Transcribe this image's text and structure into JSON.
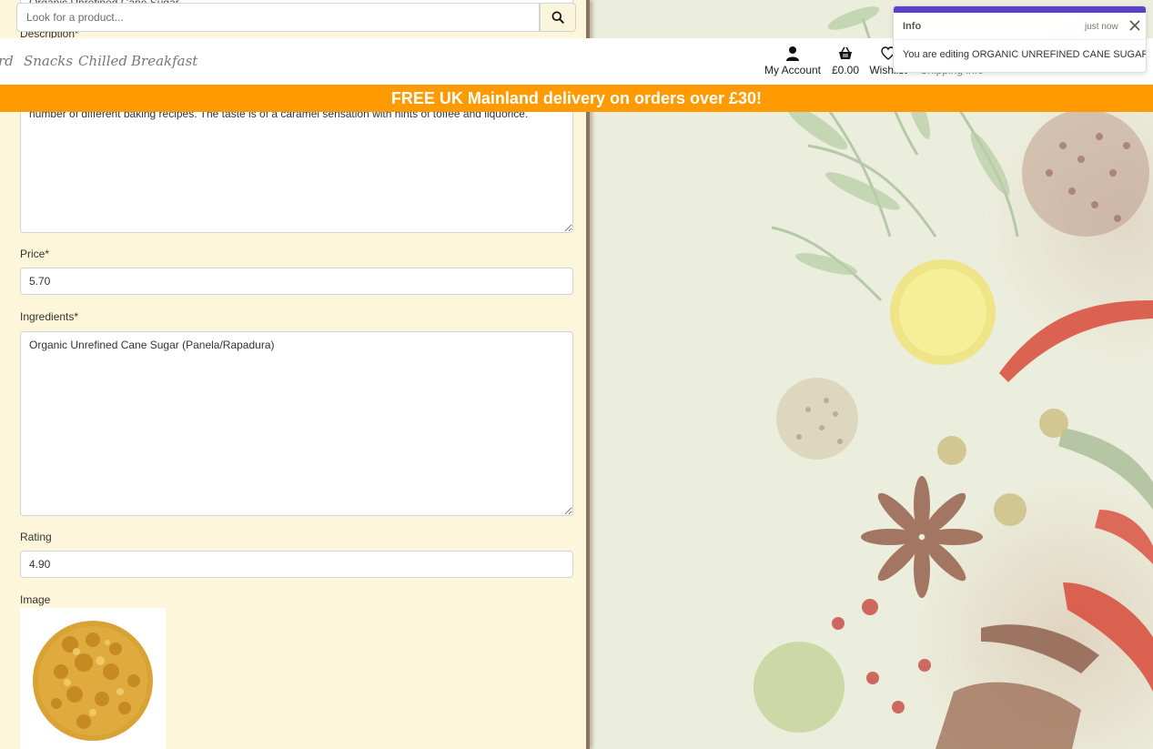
{
  "search": {
    "placeholder": "Look for a product..."
  },
  "nav": {
    "categories": [
      "rd",
      "Snacks",
      "Chilled",
      "Breakfast"
    ],
    "account_label": "My Account",
    "basket_total": "£0.00",
    "wishlist_label": "Wishlist",
    "shipping_label": "Shipping info"
  },
  "banner": {
    "highlight": "FREE UK Mainland delivery",
    "rest": " on orders over £30!"
  },
  "form": {
    "name_value_partial": "Organic Unrefined Cane Sugar",
    "description_label": "Description*",
    "description_value": "number of different baking recipes. The taste is of a caramel sensation with hints of toffee and liquorice.",
    "price_label": "Price*",
    "price_value": "5.70",
    "ingredients_label": "Ingredients*",
    "ingredients_value": "Organic Unrefined Cane Sugar (Panela/Rapadura)",
    "rating_label": "Rating",
    "rating_value": "4.90",
    "image_label": "Image"
  },
  "toast": {
    "title": "Info",
    "time": "just now",
    "message": "You are editing ORGANIC UNREFINED CANE SUGAR"
  },
  "colors": {
    "banner": "#ff9b00",
    "toast_accent": "#5b3fc9",
    "panel": "#fdf6da"
  }
}
